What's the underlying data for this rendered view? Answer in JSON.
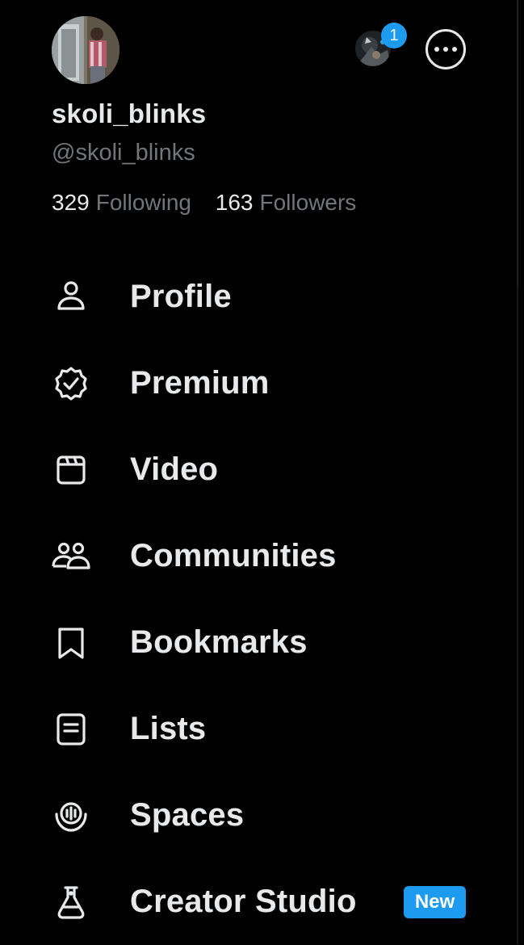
{
  "profile": {
    "display_name": "skoli_blinks",
    "handle": "@skoli_blinks",
    "following_count": "329",
    "following_label": "Following",
    "followers_count": "163",
    "followers_label": "Followers"
  },
  "account_switcher": {
    "notification_count": "1"
  },
  "menu": {
    "items": [
      {
        "label": "Profile",
        "icon": "person-icon"
      },
      {
        "label": "Premium",
        "icon": "verified-badge-icon"
      },
      {
        "label": "Video",
        "icon": "video-icon"
      },
      {
        "label": "Communities",
        "icon": "communities-icon"
      },
      {
        "label": "Bookmarks",
        "icon": "bookmark-icon"
      },
      {
        "label": "Lists",
        "icon": "list-icon"
      },
      {
        "label": "Spaces",
        "icon": "spaces-icon"
      },
      {
        "label": "Creator Studio",
        "icon": "flask-icon",
        "badge": "New"
      }
    ]
  },
  "colors": {
    "background": "#000000",
    "primary_text": "#e7e9ea",
    "secondary_text": "#71767b",
    "accent": "#1d9bf0"
  }
}
